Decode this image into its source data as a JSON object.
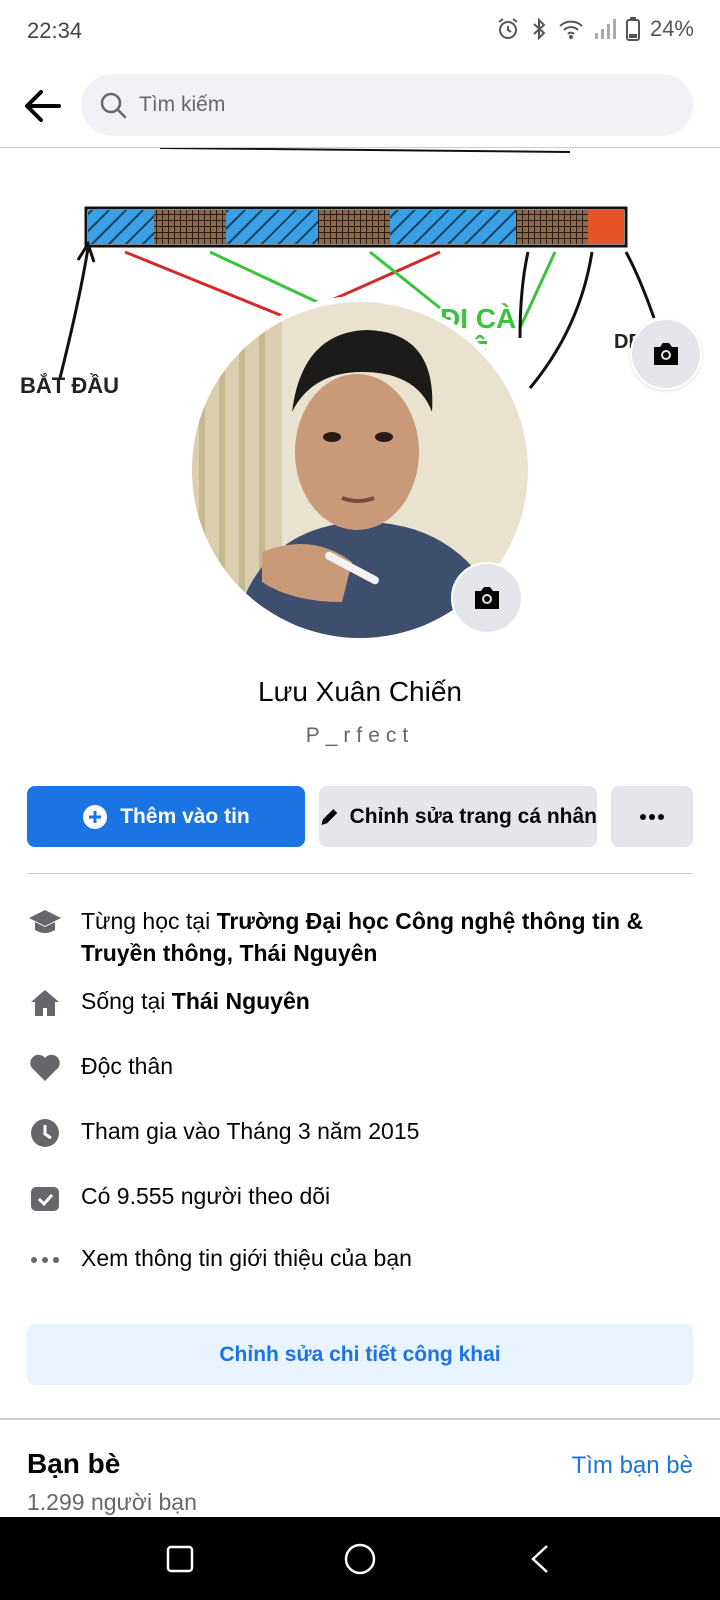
{
  "status_bar": {
    "time": "22:34",
    "battery": "24%",
    "icons": [
      "alarm-icon",
      "bluetooth-icon",
      "wifi-icon",
      "signal-icon",
      "battery-icon"
    ]
  },
  "search": {
    "placeholder": "Tìm kiếm"
  },
  "cover": {
    "annotation_start": "BẮT ĐẦU",
    "annotation_middle_1": "ĐI CÀ",
    "annotation_middle_2": "Ệ",
    "annotation_right": "DE"
  },
  "profile": {
    "name": "Lưu Xuân Chiến",
    "bio": "P_rfect"
  },
  "actions": {
    "add_story": "Thêm vào tin",
    "edit_profile": "Chỉnh sửa trang cá nhân"
  },
  "details": [
    {
      "icon": "graduation-cap-icon",
      "prefix": "Từng học tại ",
      "bold": "Trường Đại học Công nghệ thông tin & Truyền thông, Thái Nguyên"
    },
    {
      "icon": "home-icon",
      "prefix": "Sống tại ",
      "bold": "Thái Nguyên"
    },
    {
      "icon": "heart-icon",
      "prefix": "Độc thân",
      "bold": ""
    },
    {
      "icon": "clock-icon",
      "prefix": "Tham gia vào Tháng 3 năm 2015",
      "bold": ""
    },
    {
      "icon": "followers-icon",
      "prefix": "Có 9.555 người theo dõi",
      "bold": ""
    },
    {
      "icon": "more-dots-icon",
      "prefix": "Xem thông tin giới thiệu của bạn",
      "bold": ""
    }
  ],
  "edit_public": "Chỉnh sửa chi tiết công khai",
  "friends": {
    "title": "Bạn bè",
    "find_link": "Tìm bạn bè",
    "count": "1.299 người bạn"
  },
  "colors": {
    "accent": "#1b74e4",
    "secondary_bg": "#e4e6eb",
    "light_accent_bg": "#e7f3ff",
    "muted_text": "#65676b"
  }
}
